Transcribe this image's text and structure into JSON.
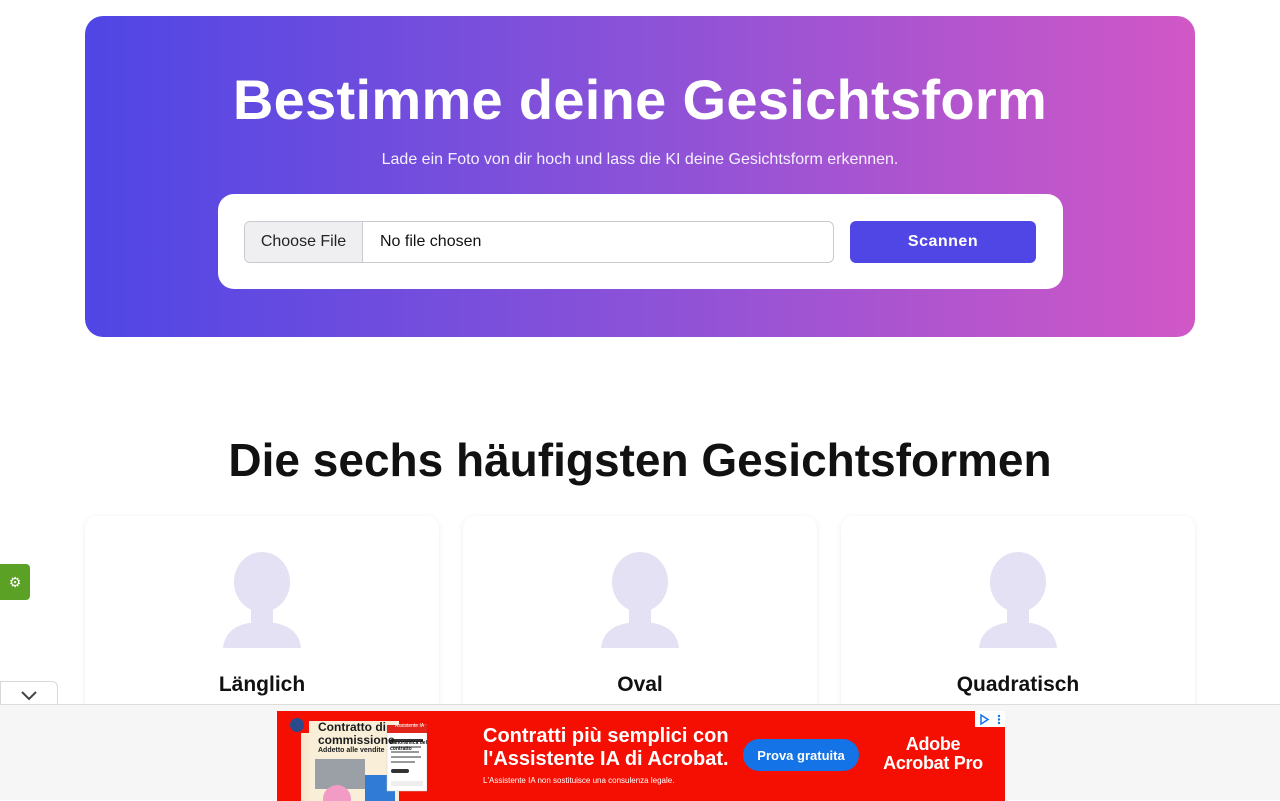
{
  "hero": {
    "title": "Bestimme deine Gesichtsform",
    "subtitle": "Lade ein Foto von dir hoch und lass die KI deine Gesichtsform erkennen.",
    "file_input": {
      "button_label": "Choose File",
      "status": "No file chosen"
    },
    "scan_button": "Scannen"
  },
  "section": {
    "title": "Die sechs häufigsten Gesichtsformen",
    "shapes": [
      {
        "name": "Länglich",
        "icon": "person-silhouette-icon"
      },
      {
        "name": "Oval",
        "icon": "person-silhouette-icon"
      },
      {
        "name": "Quadratisch",
        "icon": "person-silhouette-icon"
      }
    ]
  },
  "widgets": {
    "settings_icon": "gear-icon",
    "collapse_icon": "chevron-down-icon"
  },
  "ad": {
    "thumb_title": "Contratto di commissione",
    "thumb_subtitle": "Addetto alle vendite",
    "thumb_panel_badge": "Assistente IA",
    "thumb_panel_title": "Panoramica del contratto",
    "headline": "Contratti più semplici con\nl'Assistente IA di Acrobat.",
    "disclaimer": "L'Assistente IA non sostituisce una consulenza legale.",
    "cta": "Prova gratuita",
    "brand": "Adobe\nAcrobat Pro"
  },
  "colors": {
    "gradient_start": "#4f46e5",
    "gradient_end": "#d157c6",
    "accent": "#4f46e5",
    "silhouette": "#e3e1f3",
    "ad_red": "#f40f02",
    "ad_cta_blue": "#1473e6",
    "widget_green": "#5aa126"
  }
}
